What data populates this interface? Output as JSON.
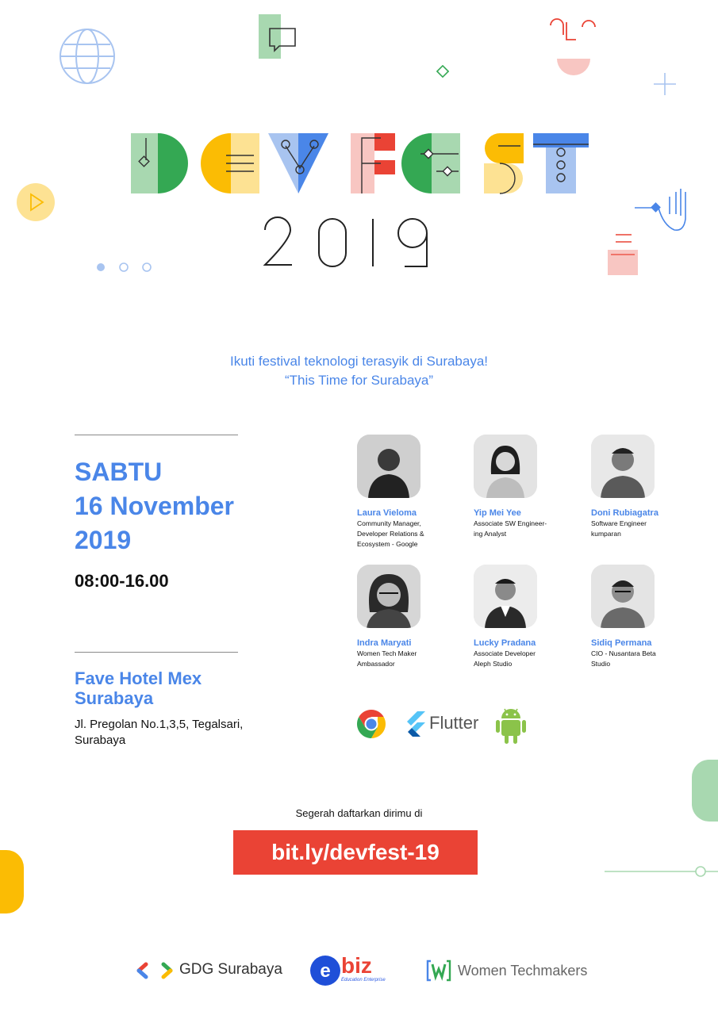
{
  "header": {
    "title_letters": [
      "D",
      "E",
      "V",
      "F",
      "E",
      "S",
      "T"
    ],
    "year": "2019"
  },
  "tagline": {
    "line1": "Ikuti festival teknologi terasyik di Surabaya!",
    "line2": "“This Time for Surabaya”"
  },
  "event": {
    "day": "SABTU",
    "date_line1": "16 November",
    "date_line2": "2019",
    "time": "08:00-16.00",
    "venue": "Fave Hotel Mex Surabaya",
    "address": "Jl. Pregolan No.1,3,5, Tegalsari, Surabaya"
  },
  "speakers": [
    {
      "name": "Laura Vieloma",
      "role": "Community Manager,\nDeveloper Relations &\nEcosystem - Google"
    },
    {
      "name": "Yip Mei Yee",
      "role": "Associate SW Engineer-\ning Analyst"
    },
    {
      "name": "Doni Rubiagatra",
      "role": "Software Engineer\nkumparan"
    },
    {
      "name": "Indra Maryati",
      "role": "Women Tech Maker\nAmbassador"
    },
    {
      "name": "Lucky Pradana",
      "role": "Associate Developer\nAleph Studio"
    },
    {
      "name": "Sidiq Permana",
      "role": "CIO - Nusantara Beta\nStudio"
    }
  ],
  "technologies": {
    "icons": [
      "chrome-icon",
      "flutter-icon",
      "android-icon"
    ],
    "flutter_label": "Flutter"
  },
  "cta": {
    "prompt": "Segerah daftarkan dirimu di",
    "link": "bit.ly/devfest-19"
  },
  "footer": {
    "gdg_label": "GDG Surabaya",
    "ebiz_label": "biz",
    "ebiz_tagline": "Education Enterprise",
    "wtm_label": "Women Techmakers"
  },
  "colors": {
    "blue": "#4a86e8",
    "red": "#ea4335",
    "yellow": "#fbbc04",
    "green": "#34a853"
  }
}
